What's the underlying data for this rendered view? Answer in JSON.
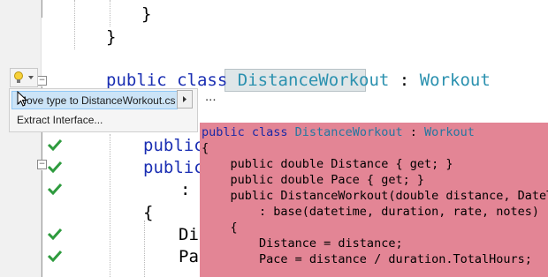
{
  "editor": {
    "top_brace_inner": "}",
    "top_brace_outer": "}",
    "class_decl": {
      "kw1": "public",
      "kw2": "class",
      "name": "DistanceWorkout",
      "colon": ":",
      "base": "Workout"
    },
    "left_lines": [
      "public",
      "public",
      ":",
      "{",
      "Di",
      "Pa"
    ]
  },
  "quick_actions": {
    "bulb_icon": "lightbulb-icon",
    "items": [
      {
        "label": "Move type to DistanceWorkout.cs",
        "selected": true
      },
      {
        "label": "Extract Interface...",
        "selected": false
      }
    ],
    "more": "..."
  },
  "preview": {
    "lines": [
      {
        "a": "public class ",
        "b": "DistanceWorkout",
        "c": " : ",
        "d": "Workout"
      },
      {
        "a": "{"
      },
      {
        "a": "    public double Distance { get; }"
      },
      {
        "a": "    public double Pace { get; }"
      },
      {
        "a": "    public DistanceWorkout(double distance, DateT"
      },
      {
        "a": "        : base(datetime, duration, rate, notes)"
      },
      {
        "a": "    {"
      },
      {
        "a": "        Distance = distance;"
      },
      {
        "a": "        Pace = distance / duration.TotalHours;"
      }
    ]
  },
  "colors": {
    "keyword": "#1b2fb3",
    "type": "#2b91af",
    "preview_bg": "#e38595",
    "check": "#2e9b3e"
  }
}
